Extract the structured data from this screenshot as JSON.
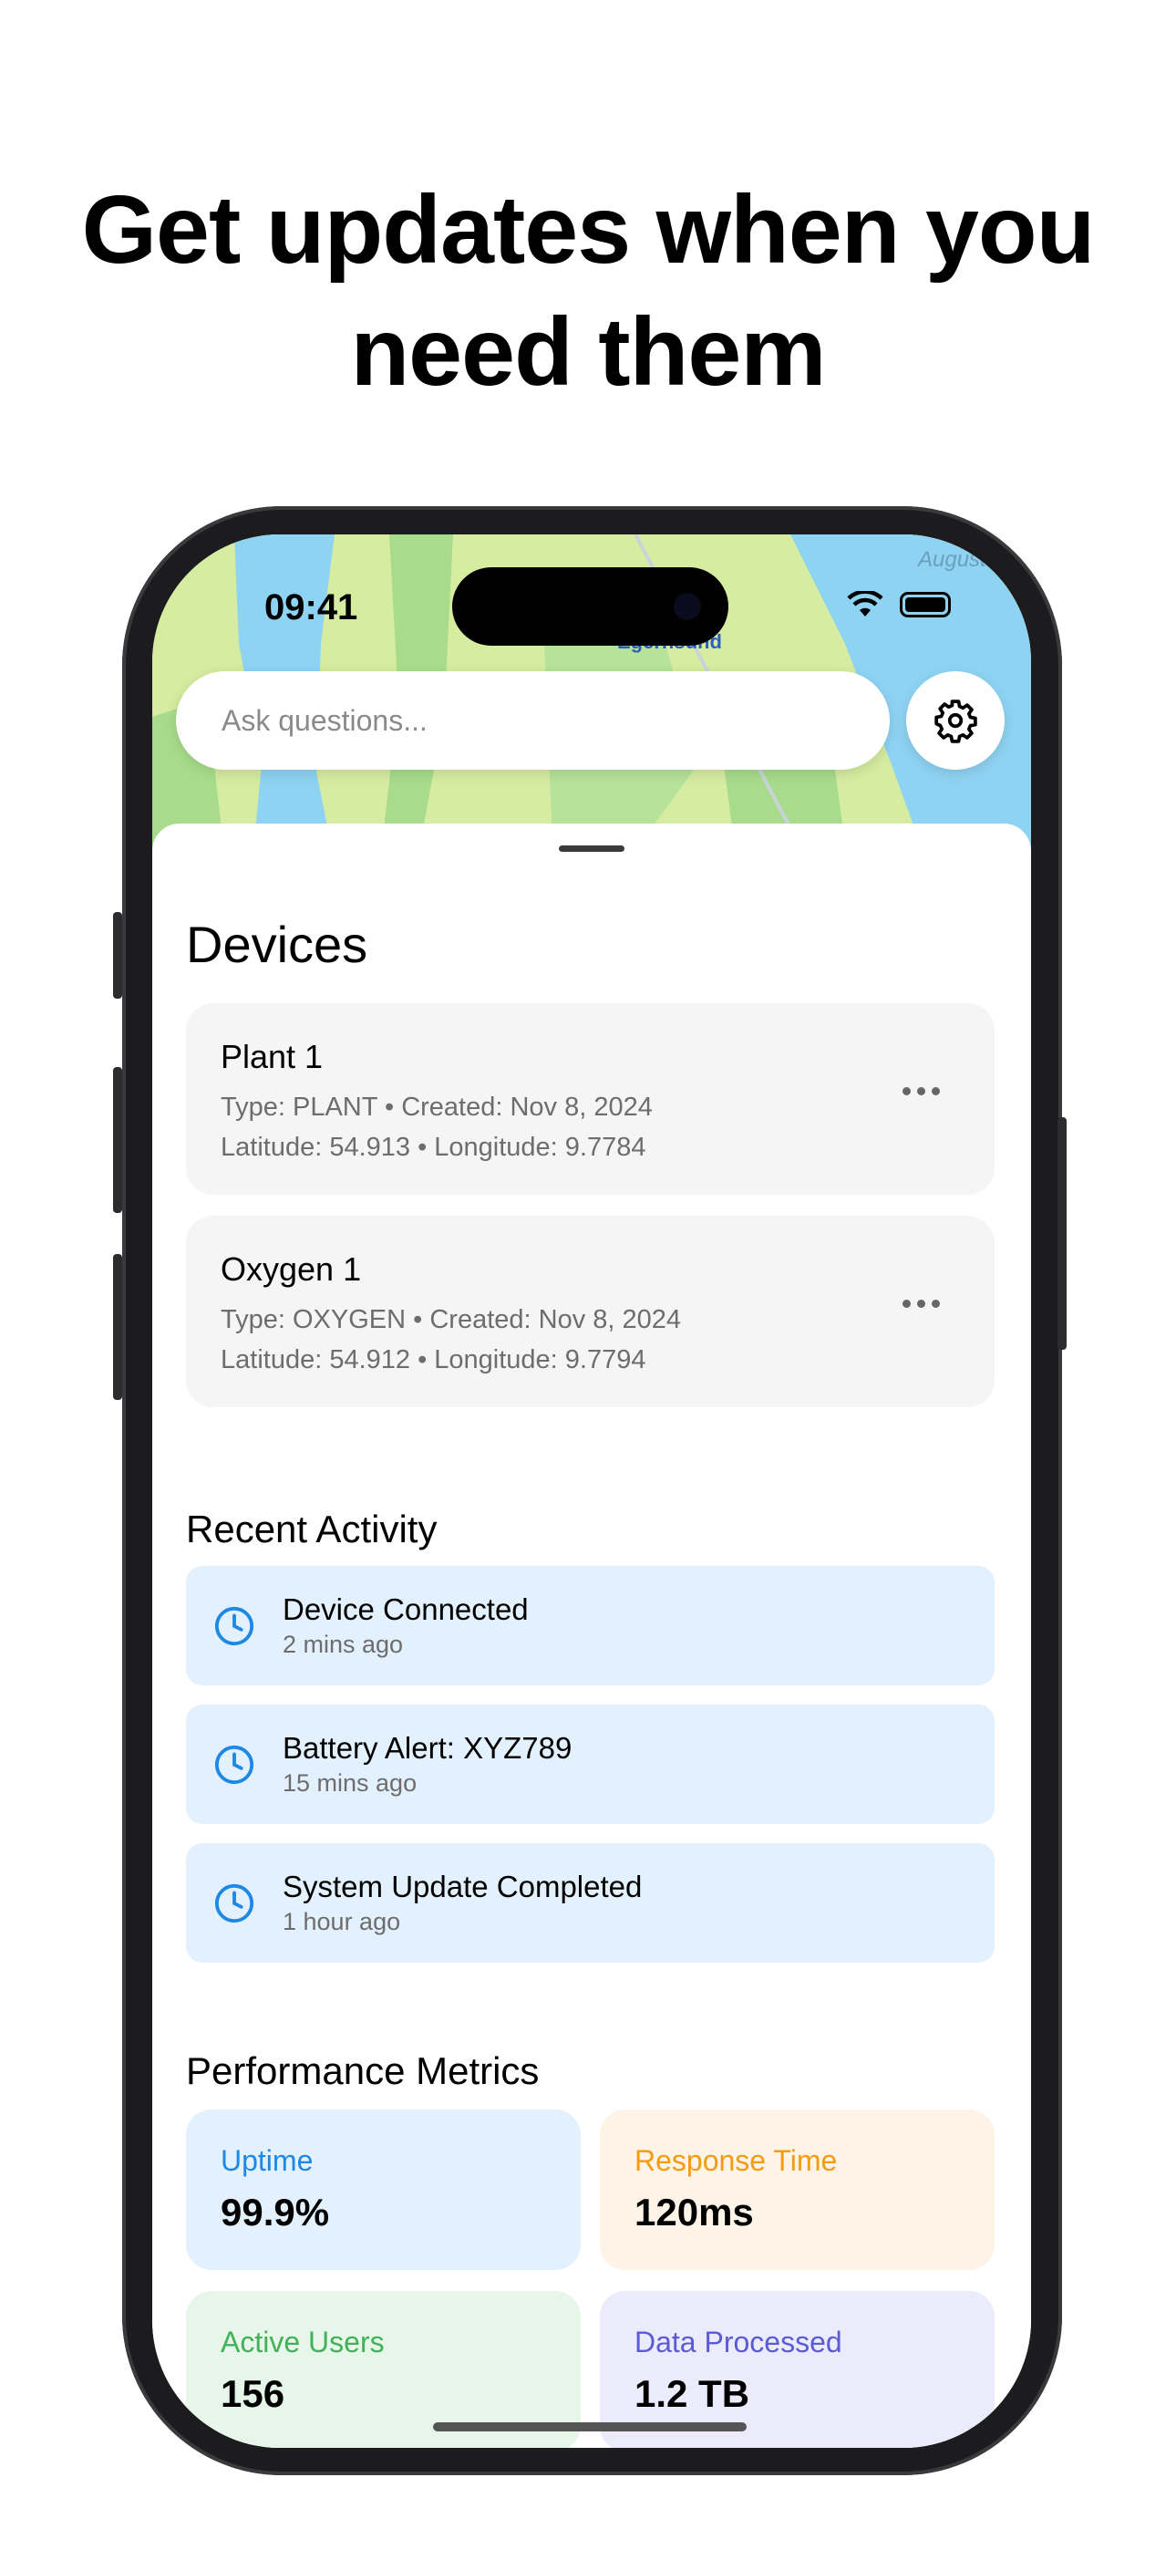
{
  "headline": {
    "line1": "Get updates when you",
    "line2": "need them"
  },
  "status_bar": {
    "time": "09:41"
  },
  "map": {
    "labels": [
      "Egernsund",
      "Augustenborg Fjord"
    ]
  },
  "search": {
    "placeholder": "Ask questions..."
  },
  "settings_icon": "gear-icon",
  "devices": {
    "title": "Devices",
    "items": [
      {
        "name": "Plant 1",
        "line1": "Type: PLANT • Created: Nov 8, 2024",
        "line2": "Latitude: 54.913 • Longitude: 9.7784"
      },
      {
        "name": "Oxygen 1",
        "line1": "Type: OXYGEN • Created: Nov 8, 2024",
        "line2": "Latitude: 54.912 • Longitude: 9.7794"
      }
    ]
  },
  "activity": {
    "title": "Recent Activity",
    "items": [
      {
        "title": "Device Connected",
        "time": "2 mins ago"
      },
      {
        "title": "Battery Alert: XYZ789",
        "time": "15 mins ago"
      },
      {
        "title": "System Update Completed",
        "time": "1 hour ago"
      }
    ]
  },
  "metrics": {
    "title": "Performance Metrics",
    "items": [
      {
        "label": "Uptime",
        "value": "99.9%",
        "bg": "#e3f0fd",
        "color": "#1e88e5"
      },
      {
        "label": "Response Time",
        "value": "120ms",
        "bg": "#fdf3e6",
        "color": "#f39c12"
      },
      {
        "label": "Active Users",
        "value": "156",
        "bg": "#e6f6e9",
        "color": "#43b05c"
      },
      {
        "label": "Data Processed",
        "value": "1.2 TB",
        "bg": "#ecebfc",
        "color": "#5b5bd6"
      }
    ]
  }
}
